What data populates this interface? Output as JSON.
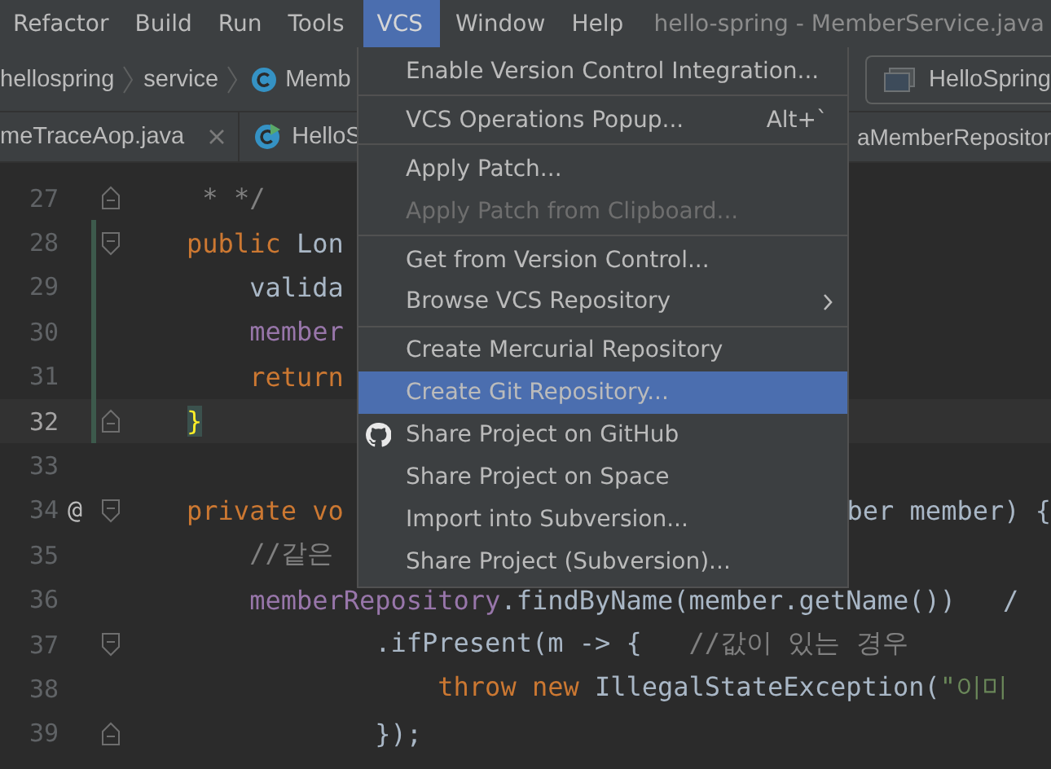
{
  "menubar": {
    "items": [
      {
        "label": "Refactor",
        "selected": false
      },
      {
        "label": "Build",
        "selected": false
      },
      {
        "label": "Run",
        "selected": false
      },
      {
        "label": "Tools",
        "selected": false
      },
      {
        "label": "VCS",
        "selected": true
      },
      {
        "label": "Window",
        "selected": false
      },
      {
        "label": "Help",
        "selected": false
      }
    ],
    "title": "hello-spring - MemberService.java"
  },
  "breadcrumbs": {
    "items": [
      {
        "label": "hellospring",
        "kind": "folder"
      },
      {
        "label": "service",
        "kind": "folder"
      },
      {
        "label": "Memb",
        "kind": "class"
      }
    ],
    "run_config": "HelloSpring"
  },
  "tabs": [
    {
      "label": "meTraceAop.java",
      "kind": "plain",
      "closable": true
    },
    {
      "label": "HelloS",
      "kind": "runnable"
    },
    {
      "label": "aMemberRepositor",
      "kind": "plain"
    }
  ],
  "editor": {
    "lines": [
      {
        "number": "27",
        "fold": {
          "kind": "end"
        },
        "changed": false,
        "current": false,
        "tokens": [
          {
            "kind": "comment",
            "text": " * */"
          }
        ]
      },
      {
        "number": "28",
        "fold": {
          "kind": "start"
        },
        "changed": true,
        "current": false,
        "tokens": [
          {
            "kind": "keyword",
            "text": "public "
          },
          {
            "kind": "plain",
            "text": "Lon"
          }
        ]
      },
      {
        "number": "29",
        "changed": true,
        "current": false,
        "tokens": [
          {
            "kind": "plain",
            "text": "    valida"
          }
        ]
      },
      {
        "number": "30",
        "changed": true,
        "current": false,
        "tokens": [
          {
            "kind": "field",
            "text": "    member"
          }
        ]
      },
      {
        "number": "31",
        "changed": true,
        "current": false,
        "tokens": [
          {
            "kind": "keyword",
            "text": "    return"
          }
        ]
      },
      {
        "number": "32",
        "fold": {
          "kind": "end"
        },
        "changed": true,
        "current": true,
        "tokens": [
          {
            "kind": "brace",
            "text": "}"
          }
        ]
      },
      {
        "number": "33",
        "changed": false,
        "current": false
      },
      {
        "number": "34",
        "fold": {
          "kind": "start"
        },
        "gutter_mark": "@",
        "changed": false,
        "current": false,
        "tokens": [
          {
            "kind": "keyword",
            "text": "private vo"
          }
        ],
        "right_tokens": [
          {
            "kind": "plain",
            "text": "ber member) {"
          }
        ]
      },
      {
        "number": "35",
        "changed": false,
        "current": false,
        "tokens": [
          {
            "kind": "comment",
            "text": "    //같은"
          }
        ]
      },
      {
        "number": "36",
        "changed": false,
        "current": false,
        "tokens": [
          {
            "kind": "field",
            "text": "    memberRepository"
          },
          {
            "kind": "plain",
            "text": ".findByName(member.getName())   /"
          }
        ]
      },
      {
        "number": "37",
        "fold": {
          "kind": "start"
        },
        "changed": false,
        "current": false,
        "tokens": [
          {
            "kind": "plain",
            "text": "            .ifPresent(m -> {   "
          },
          {
            "kind": "comment",
            "text": "//값이 있는 경우"
          }
        ]
      },
      {
        "number": "38",
        "changed": false,
        "current": false,
        "tokens": [
          {
            "kind": "keyword",
            "text": "                throw new "
          },
          {
            "kind": "plain",
            "text": "IllegalStateException("
          },
          {
            "kind": "string",
            "text": "\"이미"
          }
        ]
      },
      {
        "number": "39",
        "fold": {
          "kind": "end"
        },
        "changed": false,
        "current": false,
        "tokens": [
          {
            "kind": "plain",
            "text": "            });"
          }
        ]
      }
    ]
  },
  "popup_menu": {
    "groups": [
      [
        {
          "kind": "text",
          "label": "Enable Version Control Integration...",
          "disabled": false,
          "selected": false
        }
      ],
      [
        {
          "kind": "text",
          "label": "VCS Operations Popup...",
          "shortcut": "Alt+`",
          "disabled": false,
          "selected": false
        }
      ],
      [
        {
          "kind": "text",
          "label": "Apply Patch...",
          "disabled": false,
          "selected": false
        },
        {
          "kind": "text",
          "label": "Apply Patch from Clipboard...",
          "disabled": true,
          "selected": false
        }
      ],
      [
        {
          "kind": "text",
          "label": "Get from Version Control...",
          "disabled": false,
          "selected": false
        },
        {
          "kind": "text",
          "label": "Browse VCS Repository",
          "submenu": true,
          "disabled": false,
          "selected": false
        }
      ],
      [
        {
          "kind": "text",
          "label": "Create Mercurial Repository",
          "disabled": false,
          "selected": false
        },
        {
          "kind": "text",
          "label": "Create Git Repository...",
          "disabled": false,
          "selected": true
        },
        {
          "kind": "github",
          "label": "Share Project on GitHub",
          "disabled": false,
          "selected": false
        },
        {
          "kind": "text",
          "label": "Share Project on Space",
          "disabled": false,
          "selected": false
        },
        {
          "kind": "text",
          "label": "Import into Subversion...",
          "disabled": false,
          "selected": false
        },
        {
          "kind": "text",
          "label": "Share Project (Subversion)...",
          "disabled": false,
          "selected": false
        }
      ]
    ]
  }
}
